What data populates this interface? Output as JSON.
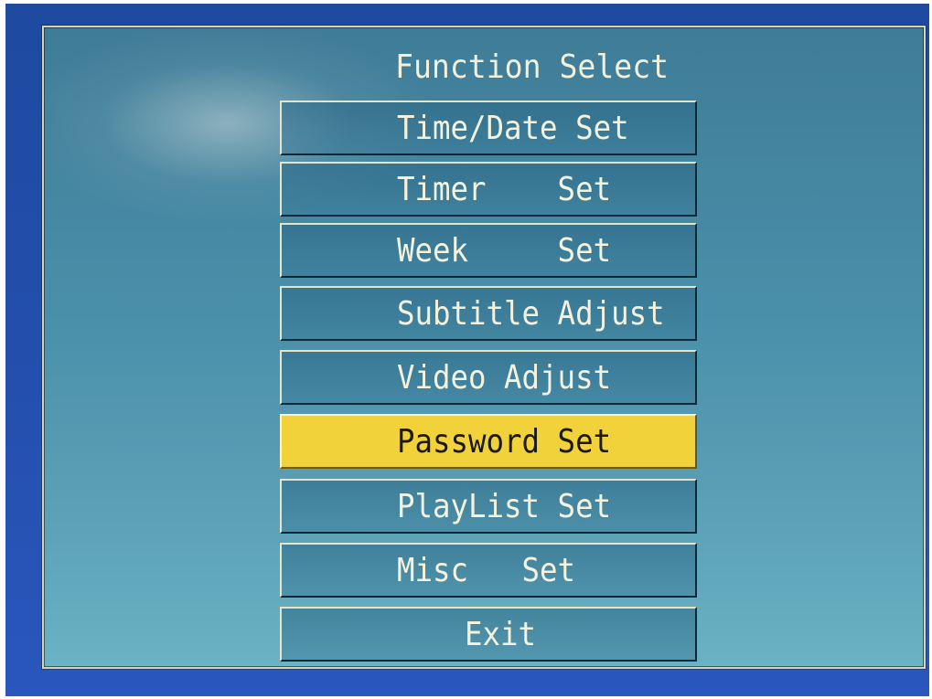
{
  "osd": {
    "title": "Function Select",
    "selected_index": 5,
    "items": [
      {
        "label": "Time/Date Set"
      },
      {
        "label": "Timer    Set"
      },
      {
        "label": "Week     Set"
      },
      {
        "label": "Subtitle Adjust"
      },
      {
        "label": "Video Adjust"
      },
      {
        "label": "Password Set"
      },
      {
        "label": "PlayList Set"
      },
      {
        "label": "Misc   Set"
      },
      {
        "label": "Exit"
      }
    ]
  },
  "colors": {
    "selected_highlight": "#f2d23a",
    "menu_text": "#f4f2dc",
    "panel_border": "#d8d6a8",
    "screen_background": "#244fae"
  }
}
